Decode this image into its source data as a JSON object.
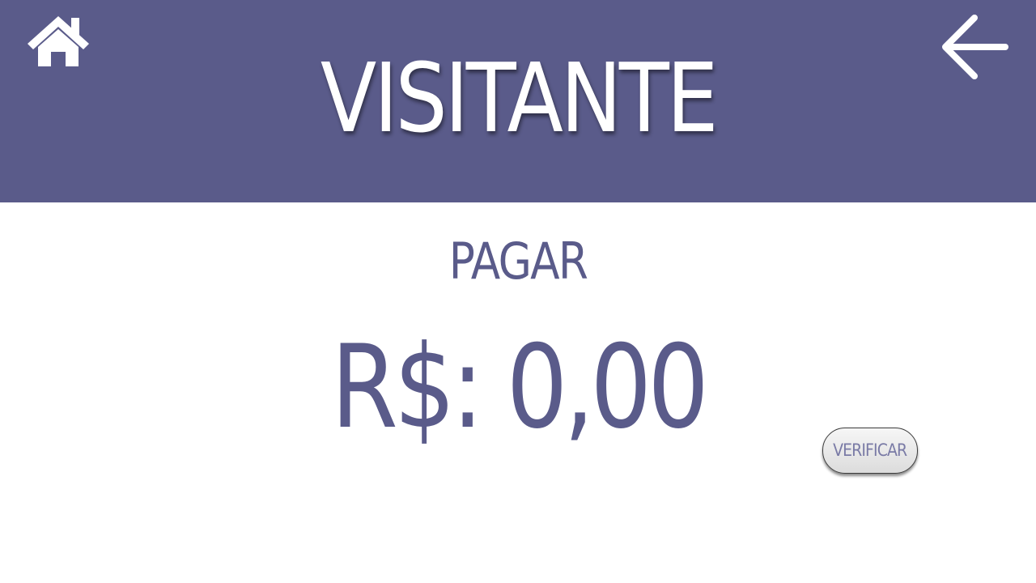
{
  "header": {
    "title": "VISITANTE",
    "background_color": "#5a5b8a",
    "home_icon": "home-icon",
    "back_icon": "arrow-left-icon"
  },
  "main": {
    "pay_label": "PAGAR",
    "amount": "R$: 0,00",
    "text_color": "#5a5b8a"
  },
  "actions": {
    "verify_label": "VERIFICAR"
  }
}
